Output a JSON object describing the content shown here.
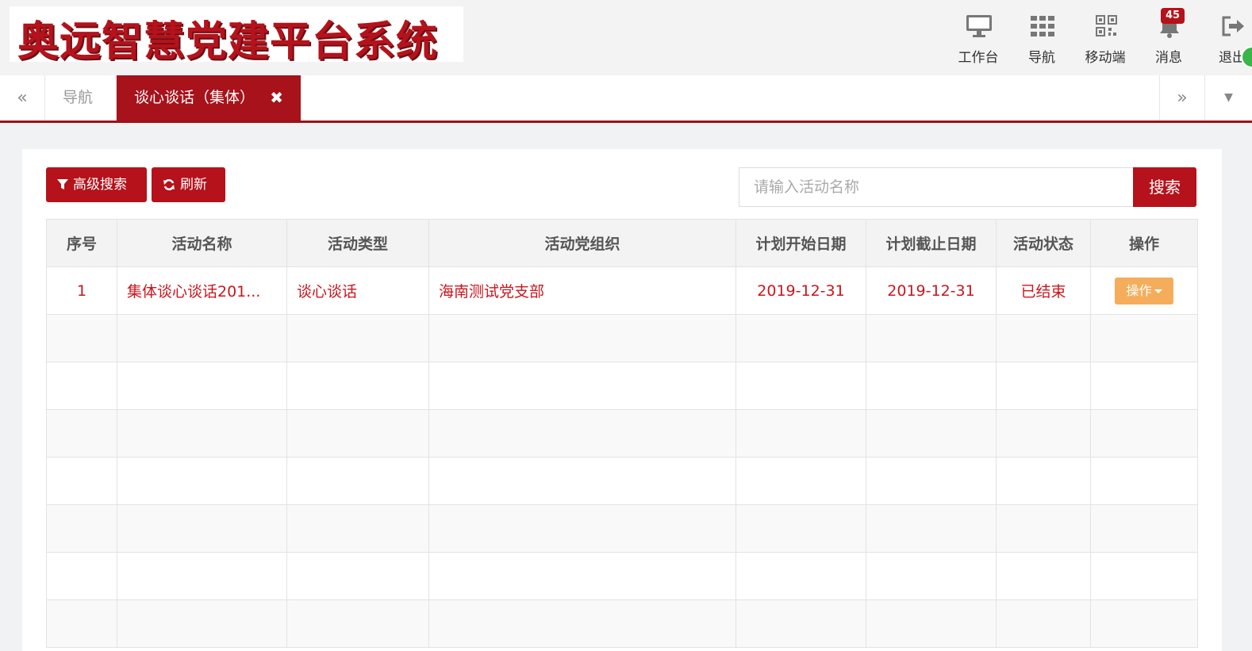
{
  "header": {
    "logo_text": "奥远智慧党建平台系统",
    "nav": [
      {
        "label": "工作台",
        "icon": "monitor-icon"
      },
      {
        "label": "导航",
        "icon": "grid-icon"
      },
      {
        "label": "移动端",
        "icon": "qrcode-icon"
      },
      {
        "label": "消息",
        "icon": "bell-icon",
        "badge": "45"
      },
      {
        "label": "退出",
        "icon": "logout-icon"
      }
    ]
  },
  "tabs": {
    "prev": "«",
    "next": "»",
    "items": [
      {
        "label": "导航"
      },
      {
        "label": "谈心谈话（集体）",
        "close": "✖"
      }
    ]
  },
  "toolbar": {
    "advanced_search": "高级搜索",
    "refresh": "刷新",
    "search_placeholder": "请输入活动名称",
    "search_button": "搜索"
  },
  "table": {
    "columns": [
      "序号",
      "活动名称",
      "活动类型",
      "活动党组织",
      "计划开始日期",
      "计划截止日期",
      "活动状态",
      "操作"
    ],
    "rows": [
      {
        "index": "1",
        "name": "集体谈心谈话201...",
        "type": "谈心谈话",
        "org": "海南测试党支部",
        "start": "2019-12-31",
        "end": "2019-12-31",
        "status": "已结束",
        "action": "操作"
      }
    ]
  },
  "colors": {
    "brand": "#b5121b",
    "action": "#f5ad5b"
  }
}
